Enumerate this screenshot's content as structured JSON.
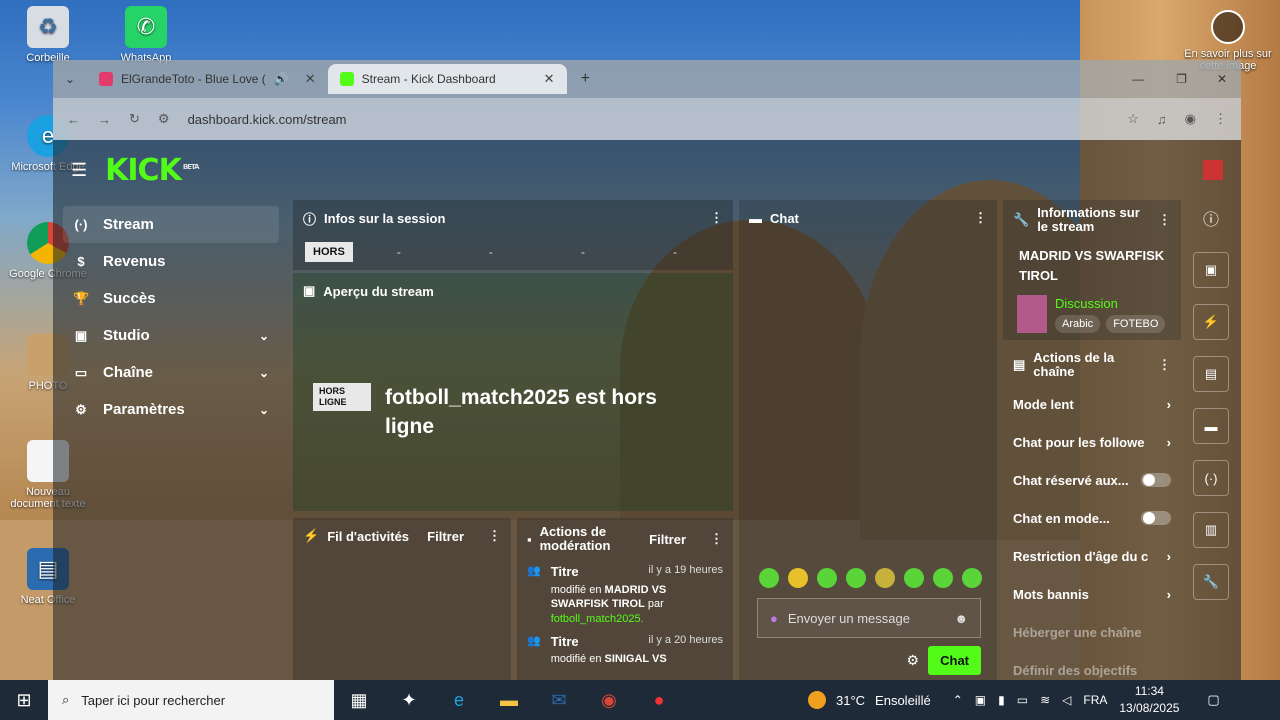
{
  "desktop": {
    "icons": [
      {
        "label": "Corbeille"
      },
      {
        "label": "WhatsApp"
      },
      {
        "label": "Microsoft Edge"
      },
      {
        "label": "Google Chrome"
      },
      {
        "label": "PHOTO"
      },
      {
        "label": "Nouveau document texte"
      },
      {
        "label": "Neat Office"
      }
    ],
    "spotlight_text": "En savoir plus sur cette image"
  },
  "browser": {
    "tabs": [
      {
        "title": "ElGrandeToto - Blue Love (",
        "active": false
      },
      {
        "title": "Stream - Kick Dashboard",
        "active": true
      }
    ],
    "new_tab": "+",
    "url": "dashboard.kick.com/stream"
  },
  "kick": {
    "logo": "KICK",
    "logo_badge": "BETA",
    "nav": [
      {
        "label": "Stream",
        "icon": "stream-icon",
        "active": true
      },
      {
        "label": "Revenus",
        "icon": "dollar-icon"
      },
      {
        "label": "Succès",
        "icon": "trophy-icon"
      },
      {
        "label": "Studio",
        "icon": "studio-icon",
        "expandable": true
      },
      {
        "label": "Chaîne",
        "icon": "channel-icon",
        "expandable": true
      },
      {
        "label": "Paramètres",
        "icon": "gear-icon",
        "expandable": true
      }
    ],
    "session": {
      "title": "Infos sur la session",
      "status": "HORS",
      "stats": [
        "-",
        "-",
        "-",
        "-"
      ]
    },
    "preview": {
      "title": "Aperçu du stream",
      "badge": "HORS LIGNE",
      "message": "fotboll_match2025 est hors ligne"
    },
    "activity": {
      "title": "Fil d'activités",
      "filter": "Filtrer"
    },
    "moderation": {
      "title": "Actions de modération",
      "filter": "Filtrer",
      "entries": [
        {
          "type": "Titre",
          "time": "il y a 19 heures",
          "prefix": "modifié en",
          "value": "MADRID VS SWARFISK TIROL",
          "by": "par",
          "user": "fotboll_match2025."
        },
        {
          "type": "Titre",
          "time": "il y a 20 heures",
          "prefix": "modifié en",
          "value": "SINIGAL VS"
        }
      ]
    },
    "chat": {
      "title": "Chat",
      "placeholder": "Envoyer un message",
      "send": "Chat"
    },
    "stream_info": {
      "title": "Informations sur le stream",
      "stream_title": "MADRID VS SWARFISK TIROL",
      "category": "Discussion",
      "tags": [
        "Arabic",
        "FOTEBO"
      ]
    },
    "channel_actions": {
      "title": "Actions de la chaîne",
      "items": [
        {
          "label": "Mode lent",
          "kind": "chevron"
        },
        {
          "label": "Chat pour les followe",
          "kind": "chevron"
        },
        {
          "label": "Chat réservé aux...",
          "kind": "toggle"
        },
        {
          "label": "Chat en mode...",
          "kind": "toggle"
        },
        {
          "label": "Restriction d'âge du c",
          "kind": "chevron"
        },
        {
          "label": "Mots bannis",
          "kind": "chevron"
        },
        {
          "label": "Héberger une chaîne",
          "kind": "dim"
        },
        {
          "label": "Définir des objectifs",
          "kind": "dim"
        }
      ]
    }
  },
  "taskbar": {
    "search_placeholder": "Taper ici pour rechercher",
    "temperature": "31°C",
    "weather": "Ensoleillé",
    "lang": "FRA",
    "time": "11:34",
    "date": "13/08/2025"
  },
  "colors": {
    "kick_green": "#53fc18",
    "taskbar": "#1f2a38"
  }
}
